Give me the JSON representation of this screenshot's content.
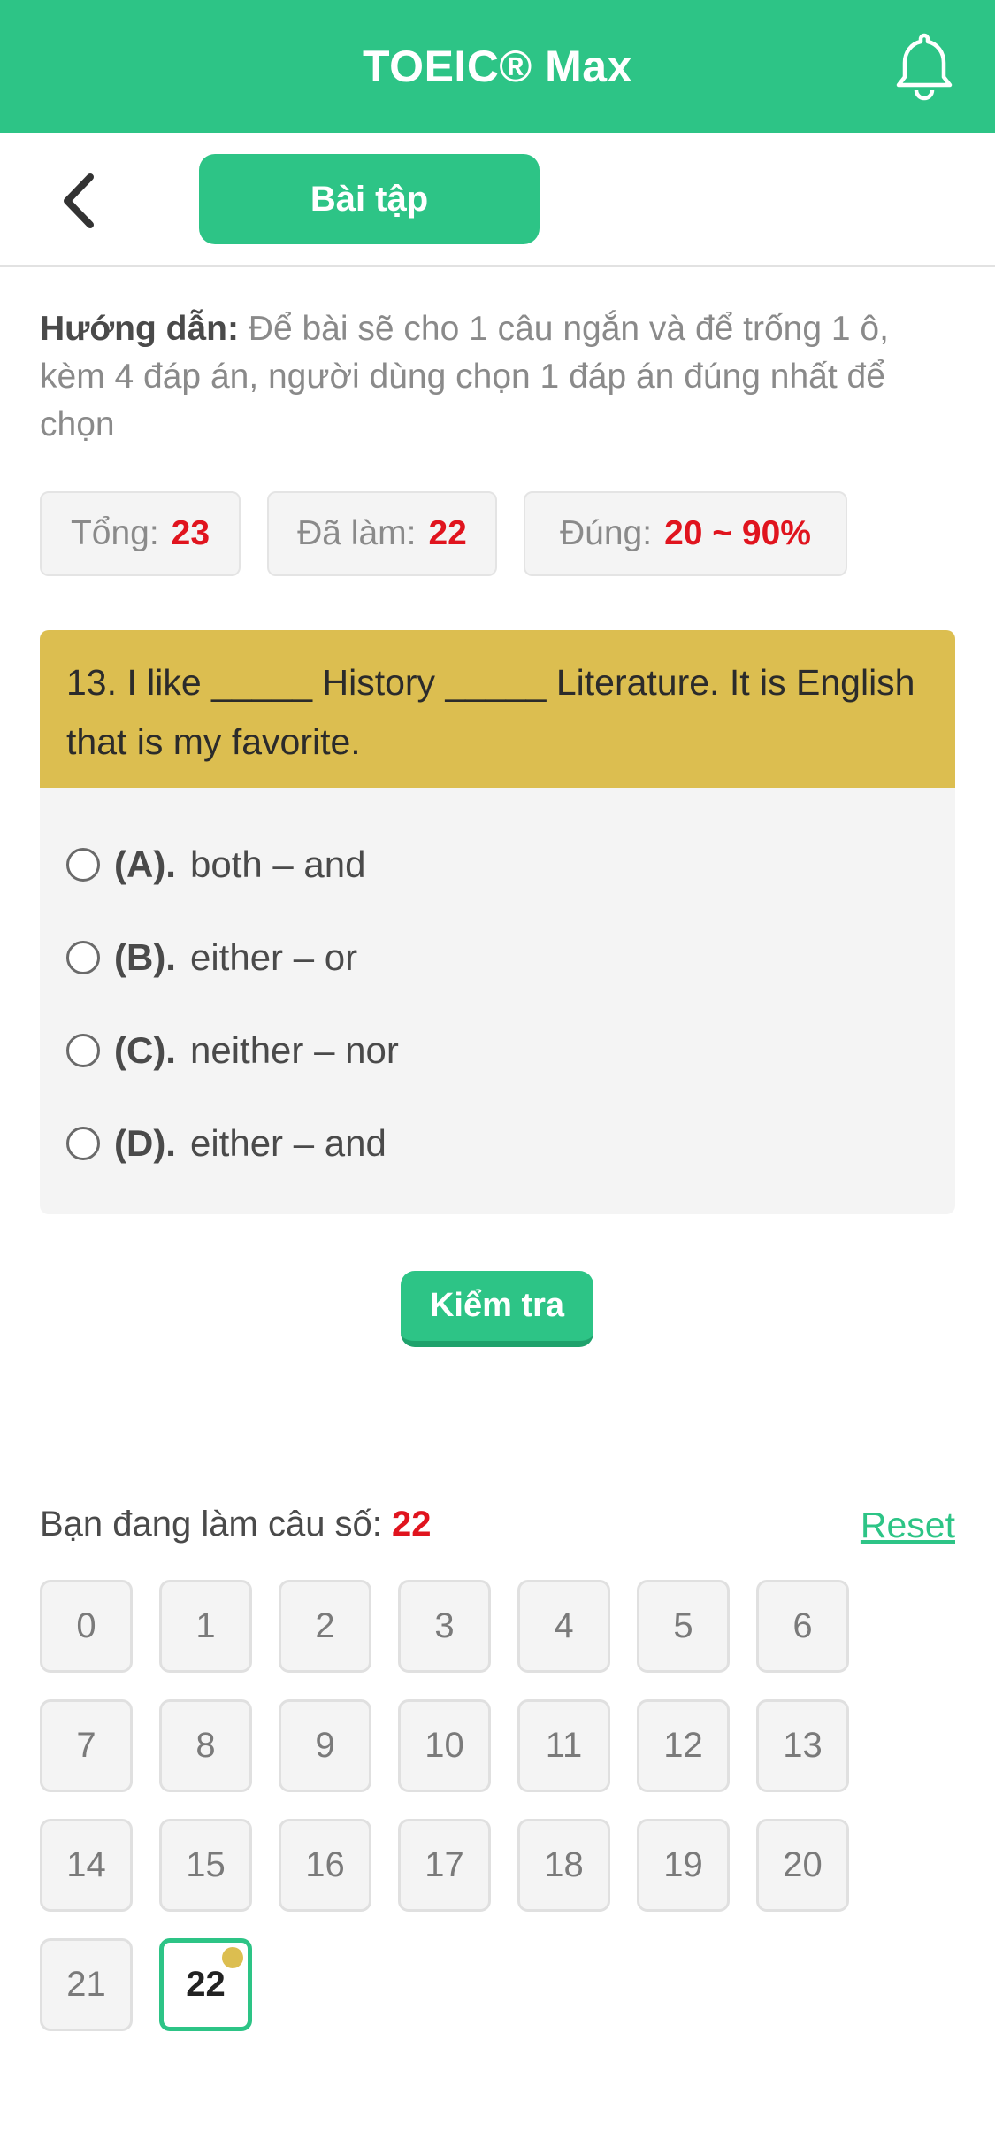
{
  "header": {
    "title": "TOEIC® Max"
  },
  "subbar": {
    "tab_label": "Bài tập"
  },
  "instructions": {
    "label": "Hướng dẫn:",
    "text": "Để bài sẽ cho 1 câu ngắn và để trống 1 ô, kèm 4 đáp án, người dùng chọn 1 đáp án đúng nhất để chọn"
  },
  "stats": [
    {
      "label": "Tổng:",
      "value": "23"
    },
    {
      "label": "Đã làm:",
      "value": "22"
    },
    {
      "label": "Đúng:",
      "value": "20 ~ 90%"
    }
  ],
  "question": {
    "text": "13. I like _____ History _____ Literature. It is English that is my favorite.",
    "options": [
      {
        "key": "(A).",
        "text": "both – and"
      },
      {
        "key": "(B).",
        "text": "either – or"
      },
      {
        "key": "(C).",
        "text": "neither – nor"
      },
      {
        "key": "(D).",
        "text": "either – and"
      }
    ]
  },
  "check_button": "Kiểm tra",
  "progress": {
    "label": "Bạn đang làm câu số:",
    "current": "22",
    "reset_label": "Reset"
  },
  "question_numbers": [
    "0",
    "1",
    "2",
    "3",
    "4",
    "5",
    "6",
    "7",
    "8",
    "9",
    "10",
    "11",
    "12",
    "13",
    "14",
    "15",
    "16",
    "17",
    "18",
    "19",
    "20",
    "21",
    "22"
  ],
  "active_question": "22",
  "colors": {
    "primary": "#2dc486",
    "question_header": "#dcbe50",
    "highlight": "#e0141e"
  },
  "icons": {
    "back": "chevron-left-icon",
    "notifications": "bell-icon"
  }
}
